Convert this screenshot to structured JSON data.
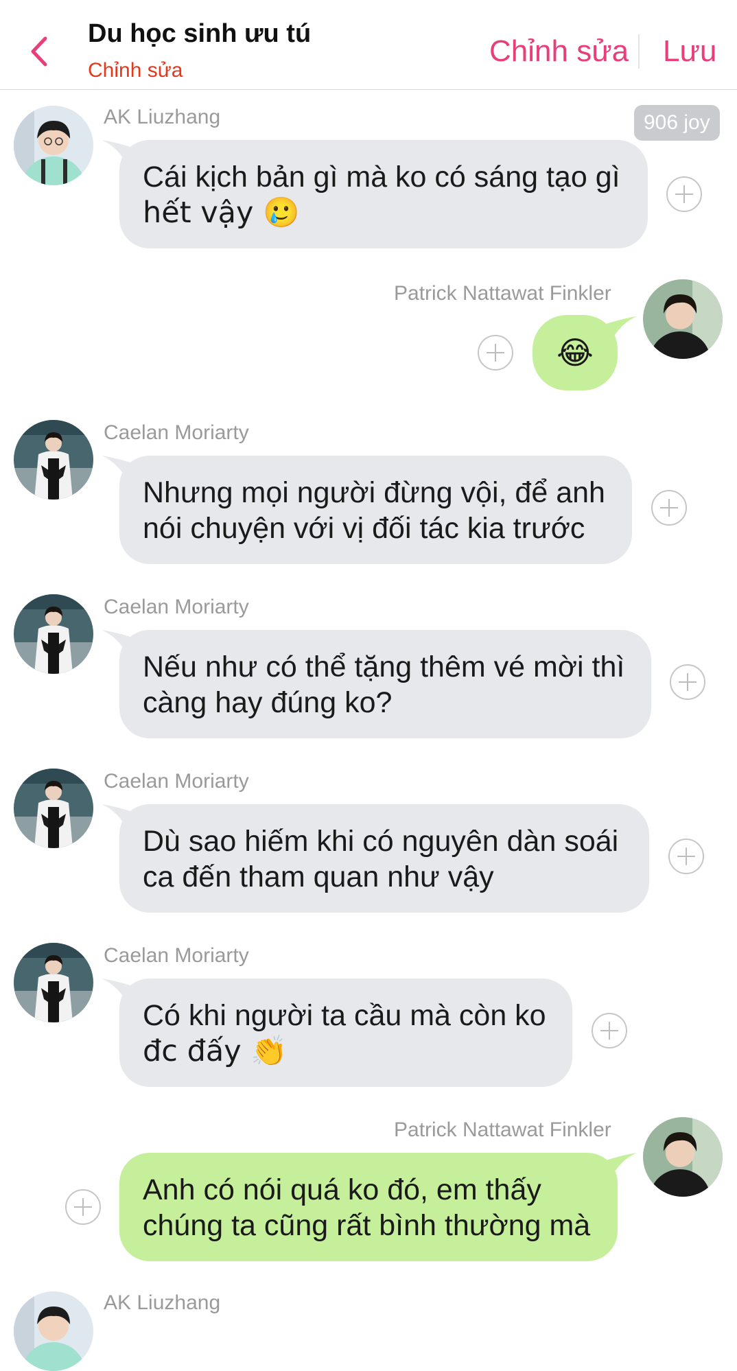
{
  "header": {
    "title": "Du học sinh ưu tú",
    "subtitle": "Chỉnh sửa",
    "edit_label": "Chỉnh sửa",
    "save_label": "Lưu"
  },
  "badge": {
    "joy_label": "906 joy"
  },
  "colors": {
    "accent_pink": "#e83e7a",
    "subtitle_red": "#e0391c",
    "incoming_bubble": "#e6e8eb",
    "outgoing_bubble": "#c5ef9b"
  },
  "messages": [
    {
      "sender": "AK Liuzhang",
      "line1": "Cái kịch bản gì mà ko có sáng tạo gì",
      "line2": "hết vậy 🥲",
      "direction": "incoming"
    },
    {
      "sender": "Patrick Nattawat Finkler",
      "line1": "😂",
      "direction": "outgoing"
    },
    {
      "sender": "Caelan Moriarty",
      "line1": "Nhưng mọi người đừng vội, để anh",
      "line2": "nói chuyện với vị đối tác kia trước",
      "direction": "incoming"
    },
    {
      "sender": "Caelan Moriarty",
      "line1": "Nếu như có thể tặng thêm vé mời thì",
      "line2": "càng hay đúng ko?",
      "direction": "incoming"
    },
    {
      "sender": "Caelan Moriarty",
      "line1": "Dù sao hiếm khi có nguyên dàn soái",
      "line2": "ca đến tham quan như vậy",
      "direction": "incoming"
    },
    {
      "sender": "Caelan Moriarty",
      "line1": "Có khi người ta cầu mà còn ko",
      "line2": "đc đấy 👏",
      "direction": "incoming"
    },
    {
      "sender": "Patrick Nattawat Finkler",
      "line1": "Anh có nói quá ko đó, em thấy",
      "line2": "chúng ta cũng rất bình thường mà",
      "direction": "outgoing"
    },
    {
      "sender": "AK Liuzhang",
      "direction": "incoming"
    }
  ]
}
